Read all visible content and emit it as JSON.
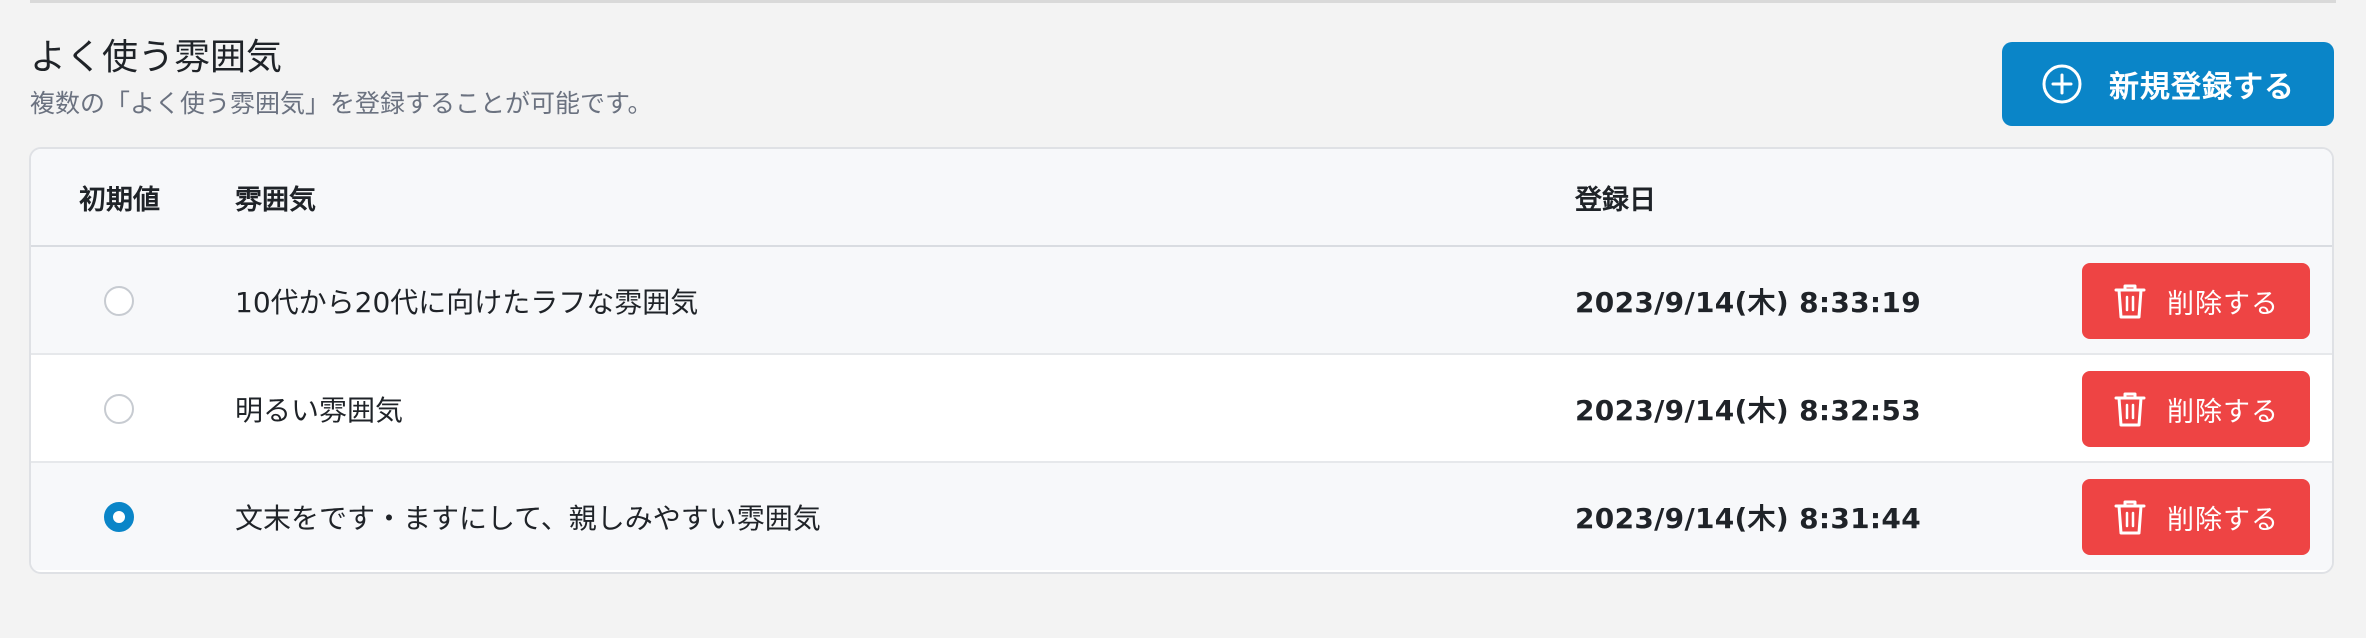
{
  "section": {
    "title": "よく使う雰囲気",
    "description": "複数の「よく使う雰囲気」を登録することが可能です。"
  },
  "add_button": {
    "label": "新規登録する",
    "icon": "plus-circle-icon"
  },
  "table": {
    "headers": {
      "default": "初期値",
      "mood": "雰囲気",
      "date": "登録日"
    },
    "rows": [
      {
        "mood": "10代から20代に向けたラフな雰囲気",
        "date": "2023/9/14(木) 8:33:19",
        "is_default": false,
        "delete_label": "削除する"
      },
      {
        "mood": "明るい雰囲気",
        "date": "2023/9/14(木) 8:32:53",
        "is_default": false,
        "delete_label": "削除する"
      },
      {
        "mood": "文末をです・ますにして、親しみやすい雰囲気",
        "date": "2023/9/14(木) 8:31:44",
        "is_default": true,
        "delete_label": "削除する"
      }
    ]
  },
  "colors": {
    "primary": "#0a85c8",
    "danger": "#ee4444",
    "background": "#f3f3f3"
  }
}
